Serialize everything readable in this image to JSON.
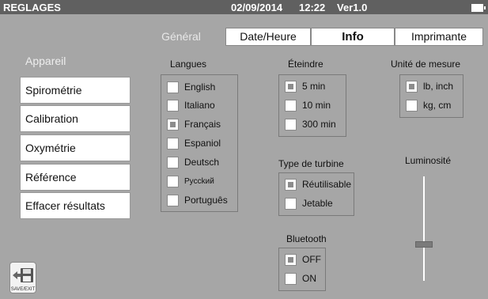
{
  "topbar": {
    "title": "REGLAGES",
    "date": "02/09/2014",
    "time": "12:22",
    "version": "Ver1.0",
    "battery_icon": "battery-icon"
  },
  "tabs": [
    {
      "label": "Général",
      "active": true
    },
    {
      "label": "Date/Heure",
      "active": false
    },
    {
      "label": "Info",
      "active": false
    },
    {
      "label": "Imprimante",
      "active": false
    }
  ],
  "sidebar": {
    "items": [
      {
        "label": "Appareil",
        "active": true
      },
      {
        "label": "Spirométrie",
        "active": false
      },
      {
        "label": "Calibration",
        "active": false
      },
      {
        "label": "Oxymétrie",
        "active": false
      },
      {
        "label": "Référence",
        "active": false
      },
      {
        "label": "Effacer résultats",
        "active": false
      }
    ]
  },
  "langues": {
    "title": "Langues",
    "options": [
      {
        "label": "English",
        "checked": false
      },
      {
        "label": "Italiano",
        "checked": false
      },
      {
        "label": "Français",
        "checked": true
      },
      {
        "label": "Espaniol",
        "checked": false
      },
      {
        "label": "Deutsch",
        "checked": false
      },
      {
        "label": "Pycckий",
        "checked": false
      },
      {
        "label": "Português",
        "checked": false
      }
    ]
  },
  "eteindre": {
    "title": "Éteindre",
    "options": [
      {
        "label": "5 min",
        "checked": true
      },
      {
        "label": "10 min",
        "checked": false
      },
      {
        "label": "300 min",
        "checked": false
      }
    ]
  },
  "unite": {
    "title": "Unité de mesure",
    "options": [
      {
        "label": "lb, inch",
        "checked": true
      },
      {
        "label": "kg, cm",
        "checked": false
      }
    ]
  },
  "turbine": {
    "title": "Type de turbine",
    "options": [
      {
        "label": "Réutilisable",
        "checked": true
      },
      {
        "label": "Jetable",
        "checked": false
      }
    ]
  },
  "bluetooth": {
    "title": "Bluetooth",
    "options": [
      {
        "label": "OFF",
        "checked": true
      },
      {
        "label": "ON",
        "checked": false
      }
    ]
  },
  "luminosite": {
    "title": "Luminosité",
    "level": 0.35
  },
  "save": {
    "label": "SAVE/EXIT",
    "icon": "floppy-save-icon"
  },
  "colors": {
    "background": "#a6a6a6",
    "topbar": "#606060",
    "checkbox_fill": "#8c8c8c"
  }
}
